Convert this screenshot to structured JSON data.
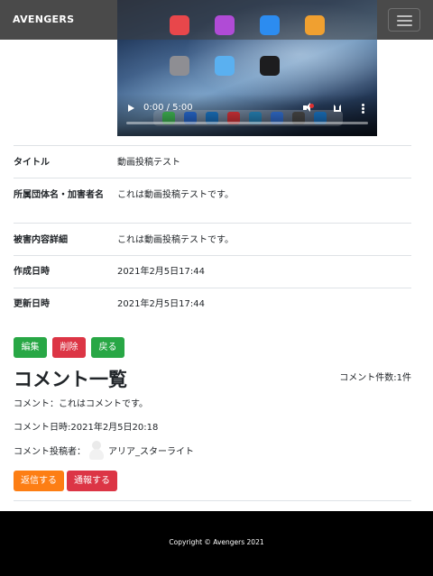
{
  "navbar": {
    "brand": "AVENGERS",
    "menu_icon": "hamburger-menu-icon"
  },
  "video": {
    "time": "0:00 / 5:00",
    "progress": 0
  },
  "details": [
    {
      "label": "タイトル",
      "value": "動画投稿テスト"
    },
    {
      "label": "所属団体名・加害者名",
      "value": "これは動画投稿テストです。"
    },
    {
      "label": "被害内容詳細",
      "value": "これは動画投稿テストです。"
    },
    {
      "label": "作成日時",
      "value": "2021年2月5日17:44"
    },
    {
      "label": "更新日時",
      "value": "2021年2月5日17:44"
    }
  ],
  "actions": {
    "edit": "編集",
    "delete": "削除",
    "back": "戻る"
  },
  "comments": {
    "heading": "コメント一覧",
    "count": "コメント件数:1件",
    "items": [
      {
        "text": "コメント：これはコメントです。",
        "datetime": "コメント日時:2021年2月5日20:18",
        "poster_label": "コメント投稿者：",
        "poster_name": "アリア_スターライト",
        "reply": "返信する",
        "report": "通報する"
      }
    ]
  },
  "footer": {
    "copyright": "Copyright © Avengers 2021"
  },
  "colors": {
    "navbar": "#4a4a4a",
    "success": "#28a745",
    "danger": "#dc3545",
    "warning": "#fd7e14",
    "footer": "#000000"
  }
}
